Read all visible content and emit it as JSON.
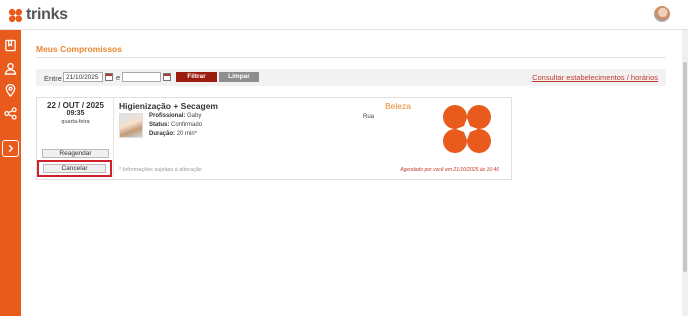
{
  "brand": {
    "name": "trinks",
    "accent": "#e85b1c"
  },
  "header": {
    "avatar_icon": "user-avatar"
  },
  "sidebar": {
    "items": [
      {
        "icon": "calendar-book-icon"
      },
      {
        "icon": "user-icon"
      },
      {
        "icon": "map-pin-icon"
      },
      {
        "icon": "share-icon"
      }
    ],
    "expand_icon": "chevron-right-icon"
  },
  "page": {
    "title": "Meus Compromissos"
  },
  "filter": {
    "between_label": "Entre",
    "start_date": "21/10/2025",
    "and_label": "e",
    "end_date": "",
    "filter_button": "Filtrar",
    "clear_button": "Limpar",
    "consult_link": "Consultar estabelecimentos / horários"
  },
  "appointment": {
    "date": "22 / OUT / 2025",
    "time": "09:35",
    "weekday": "quarta-feira",
    "reschedule_button": "Reagendar",
    "cancel_button": "Cancelar",
    "service": "Higienização + Secagem",
    "category": "Beleza",
    "professional_label": "Profissional:",
    "professional": "Gaby",
    "status_label": "Status:",
    "status": "Confirmado",
    "duration_label": "Duração:",
    "duration": "20 min*",
    "address": "Rua",
    "note": "* Informações sujeitas à alteração",
    "scheduled_info": "Agendado por você em 21/10/2025 às 16:46"
  },
  "colors": {
    "title_orange": "#e8862f",
    "filter_red": "#9b1b0e",
    "cancel_highlight": "#d0222b"
  }
}
